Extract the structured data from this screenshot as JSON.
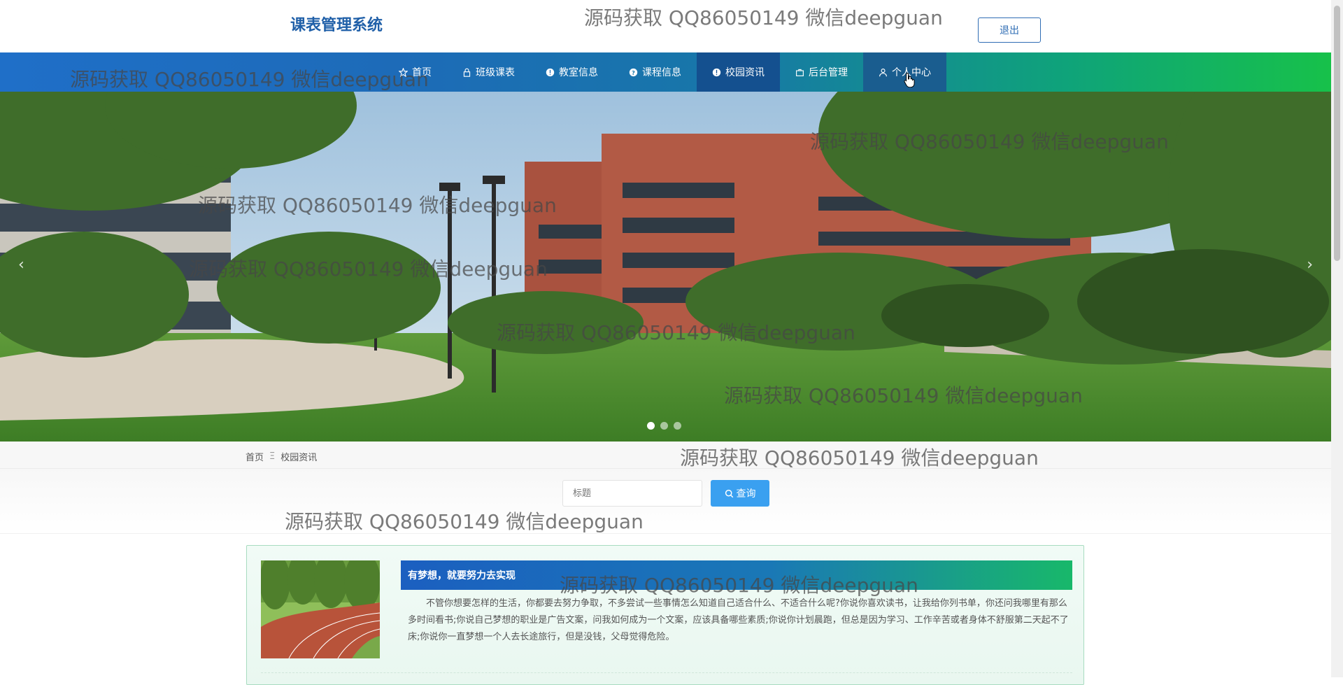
{
  "header": {
    "site_title": "课表管理系统",
    "logout_label": "退出"
  },
  "nav": {
    "items": [
      {
        "label": "首页",
        "icon": "star-icon"
      },
      {
        "label": "班级课表",
        "icon": "lock-icon"
      },
      {
        "label": "教室信息",
        "icon": "info-icon"
      },
      {
        "label": "课程信息",
        "icon": "question-icon"
      },
      {
        "label": "校园资讯",
        "icon": "info-icon",
        "active": true
      },
      {
        "label": "后台管理",
        "icon": "briefcase-icon"
      },
      {
        "label": "个人中心",
        "icon": "user-icon",
        "hovered": true
      }
    ]
  },
  "carousel": {
    "prev_label": "‹",
    "next_label": "›",
    "slide_count": 3,
    "active_slide": 1
  },
  "breadcrumb": {
    "home": "首页",
    "separator": "Ξ",
    "current": "校园资讯"
  },
  "search": {
    "placeholder": "标题",
    "button_label": "查询"
  },
  "news": [
    {
      "title": "有梦想，就要努力去实现",
      "body": "不管你想要怎样的生活，你都要去努力争取，不多尝试一些事情怎么知道自己适合什么、不适合什么呢?你说你喜欢读书，让我给你列书单，你还问我哪里有那么多时间看书;你说自己梦想的职业是广告文案，问我如何成为一个文案，应该具备哪些素质;你说你计划晨跑，但总是因为学习、工作辛苦或者身体不舒服第二天起不了床;你说你一直梦想一个人去长途旅行，但是没钱，父母觉得危险。"
    }
  ],
  "watermark": "源码获取 QQ86050149 微信deepguan",
  "colors": {
    "brand_blue": "#1f5fa8",
    "nav_start": "#1f6fc8",
    "nav_end": "#17c14a",
    "search_button": "#3aa0f0"
  }
}
